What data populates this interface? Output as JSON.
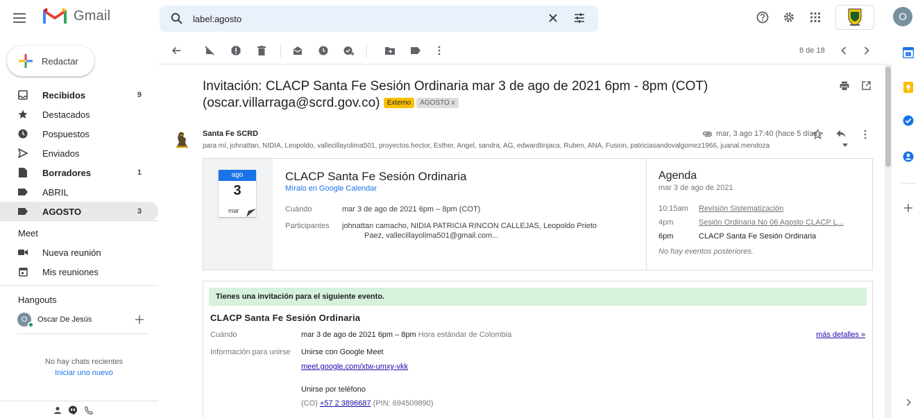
{
  "app": {
    "name": "Gmail"
  },
  "search": {
    "value": "label:agosto"
  },
  "compose": {
    "label": "Redactar"
  },
  "nav": {
    "items": [
      {
        "label": "Recibidos",
        "count": "9"
      },
      {
        "label": "Destacados",
        "count": ""
      },
      {
        "label": "Pospuestos",
        "count": ""
      },
      {
        "label": "Enviados",
        "count": ""
      },
      {
        "label": "Borradores",
        "count": "1"
      },
      {
        "label": "ABRIL",
        "count": ""
      },
      {
        "label": "AGOSTO",
        "count": "3"
      }
    ]
  },
  "meet": {
    "title": "Meet",
    "new_meeting": "Nueva reunión",
    "my_meetings": "Mis reuniones"
  },
  "hangouts": {
    "title": "Hangouts",
    "user_initial": "O",
    "user_name": "Oscar De Jesús",
    "no_chats": "No hay chats recientes",
    "start_new": "Iniciar uno nuevo"
  },
  "user": {
    "avatar_initial": "O"
  },
  "pager": {
    "text": "8 de 18"
  },
  "message": {
    "subject_line1": "Invitación: CLACP Santa Fe Sesión Ordinaria mar 3 de ago de 2021 6pm - 8pm (COT)",
    "subject_line2": "(oscar.villarraga@scrd.gov.co)",
    "label_external": "Externo",
    "label_agosto": "AGOSTO",
    "label_remove": "x",
    "sender": "Santa Fe SCRD",
    "recipients": "para mí, johnattan, NIDIA, Leopoldo, vallecillayolima501, proyectos.hector, Esther, Angel, sandra, AG, edwardtinjaca, Ruben, ANA, Fusion, patriciasandovalgomez1966, juanal.mendoza",
    "date": "mar, 3 ago 17:40 (hace 5 días)"
  },
  "calendar_card": {
    "month": "ago",
    "day": "3",
    "weekday": "mar",
    "title": "CLACP Santa Fe Sesión Ordinaria",
    "link": "Míralo en Google Calendar",
    "when_label": "Cuándo",
    "when_value": "mar 3 de ago de 2021 6pm – 8pm (COT)",
    "participants_label": "Participantes",
    "participants_line1": "johnattan camacho, NIDIA PATRICIA RINCON CALLEJAS, Leopoldo Prieto",
    "participants_line2": "Paez, vallecillayolima501@gmail.com..."
  },
  "agenda": {
    "title": "Agenda",
    "date": "mar 3 de ago de 2021",
    "items": [
      {
        "time": "10:15am",
        "name": "Revisión Sistematización"
      },
      {
        "time": "4pm",
        "name": "Sesión Ordinaria No 06 Agosto CLACP L..."
      },
      {
        "time": "6pm",
        "name": "CLACP Santa Fe Sesión Ordinaria"
      }
    ],
    "no_more": "No hay eventos posteriores."
  },
  "invitation": {
    "banner": "Tienes una invitación para el siguiente evento.",
    "title": "CLACP Santa Fe Sesión Ordinaria",
    "when_label": "Cuándo",
    "when_value": "mar 3 de ago de 2021 6pm – 8pm",
    "when_tz": "Hora estándar de Colombia",
    "more_details": "más detalles »",
    "join_label": "Información para unirse",
    "join_meet": "Unirse con Google Meet",
    "meet_link": "meet.google.com/xtw-umxy-vkk",
    "join_phone": "Unirse por teléfono",
    "phone_prefix": "(CO)",
    "phone_number": "+57 2 3896687",
    "phone_pin": "(PIN: 694509890)"
  }
}
